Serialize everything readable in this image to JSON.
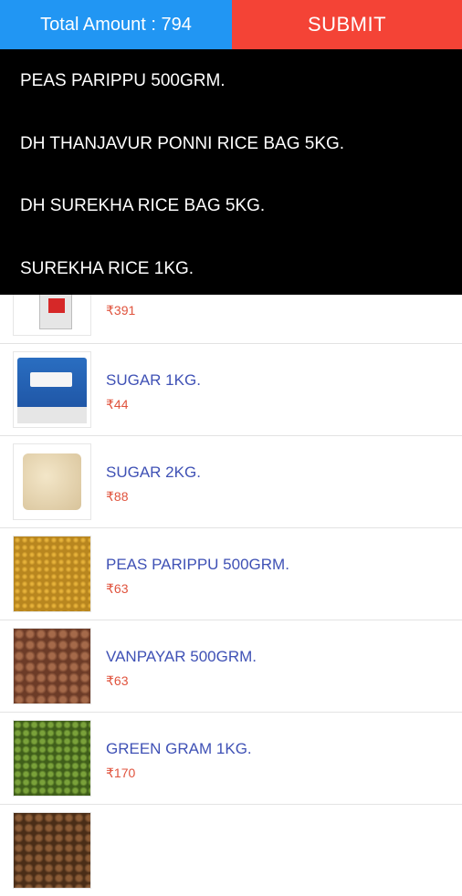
{
  "header": {
    "total_label": "Total Amount : 794",
    "submit_label": "SUBMIT"
  },
  "cart_dropdown": {
    "items": [
      "PEAS PARIPPU 500GRM.",
      "DH THANJAVUR PONNI RICE BAG 5KG.",
      "DH SUREKHA RICE BAG 5KG.",
      "SUREKHA RICE 1KG."
    ]
  },
  "products": [
    {
      "name": "",
      "price": "₹391"
    },
    {
      "name": "SUGAR 1KG.",
      "price": "₹44"
    },
    {
      "name": "SUGAR 2KG.",
      "price": "₹88"
    },
    {
      "name": "PEAS PARIPPU 500GRM.",
      "price": "₹63"
    },
    {
      "name": "VANPAYAR 500GRM.",
      "price": "₹63"
    },
    {
      "name": "GREEN GRAM 1KG.",
      "price": "₹170"
    },
    {
      "name": "",
      "price": ""
    }
  ],
  "colors": {
    "total_bg": "#2196f3",
    "submit_bg": "#f44336",
    "product_name": "#3f51b5",
    "price": "#e0533d"
  }
}
